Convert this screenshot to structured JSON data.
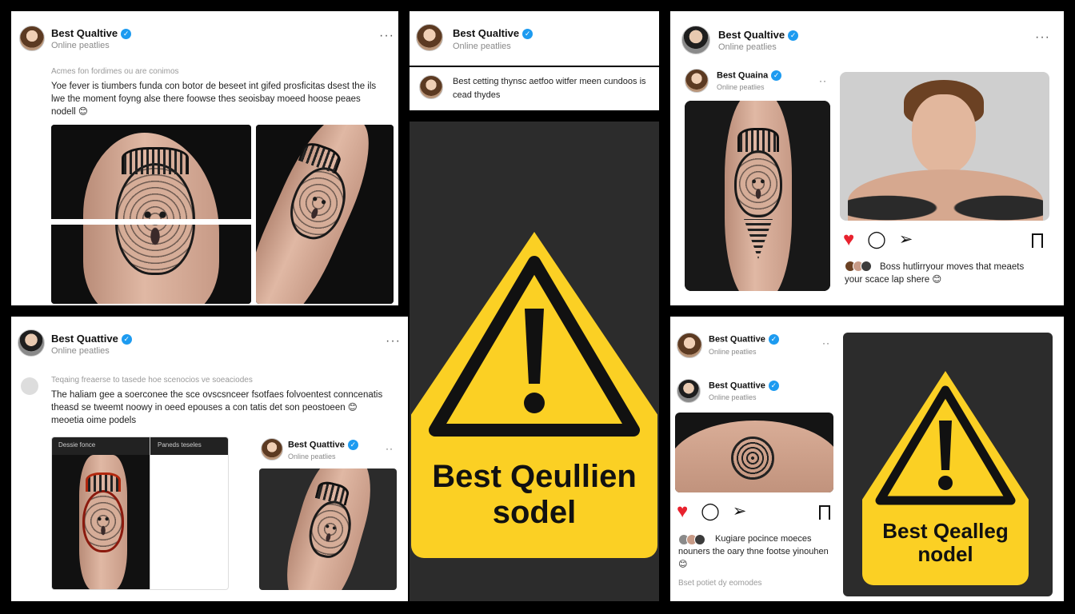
{
  "panel1": {
    "username": "Best Qualtive",
    "subtitle": "Online peatlies",
    "meta": "Acmes fon fordimes ou are conimos",
    "body": "Yoe fever is tiumbers funda con botor de beseet int gifed prosficitas dsest the ils lwe the moment foyng alse there foowse thes seoisbay moeed hoose peaes nodell 😊"
  },
  "panel2": {
    "username": "Best Qualtive",
    "subtitle": "Online peatlies",
    "comment": "Best cetting thynsc aetfoo witfer meen cundoos is cead thydes"
  },
  "panel3": {
    "username": "Best Qualtive",
    "subtitle": "Online peatlies",
    "inner_username": "Best Quaina",
    "inner_subtitle": "Online peatlies",
    "caption": "Boss hutlirryour moves that meaets your scace lap shere 😊"
  },
  "panel4": {
    "username": "Best Quattive",
    "subtitle": "Online peatlies",
    "meta": "Teqaing freaerse to tasede hoe scenocios ve soeaciodes",
    "body": "The haliam gee a soerconee the sce ovscsnceer fsotfaes folvoentest conncenatis theasd se tweemt noowy in oeed epouses a con tatis det son peostoeen 😊 meoetia oime podels",
    "tab1": "Dessie fonce",
    "tab2": "Paneds teseles",
    "nested_username": "Best Quattive",
    "nested_subtitle": "Online peatlies"
  },
  "warning_center": {
    "line1": "Best Qeullien",
    "line2": "sodel"
  },
  "panel6": {
    "username": "Best Quattive",
    "subtitle": "Online peatlies",
    "inner_username": "Best Quattive",
    "inner_subtitle": "Online peatlies",
    "caption": "Kugiare pocince moeces nouners the oary thne footse yinouhen 😊",
    "footer": "Bset potiet dy eomodes",
    "warn_line1": "Best Qealleg",
    "warn_line2": "nodel"
  },
  "colors": {
    "verified": "#1d9bf0",
    "warning_yellow": "#fbd024",
    "heart": "#e8222e"
  }
}
